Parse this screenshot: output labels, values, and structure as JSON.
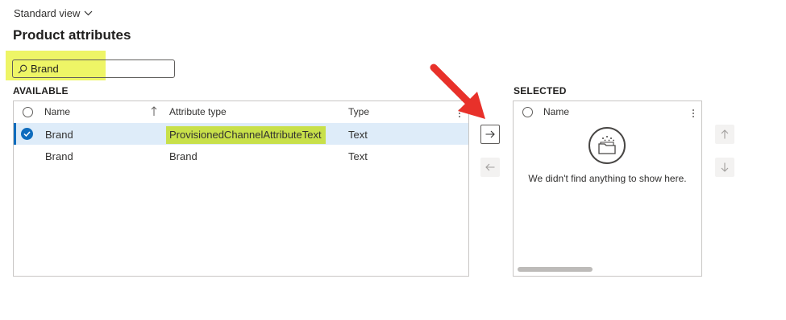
{
  "header": {
    "view_label": "Standard view",
    "title": "Product attributes"
  },
  "search": {
    "value": "Brand",
    "placeholder": ""
  },
  "available": {
    "label": "AVAILABLE",
    "columns": [
      "Name",
      "Attribute type",
      "Type"
    ],
    "rows": [
      {
        "name": "Brand",
        "attribute_type": "ProvisionedChannelAttributeText",
        "type": "Text",
        "selected": true
      },
      {
        "name": "Brand",
        "attribute_type": "Brand",
        "type": "Text",
        "selected": false
      }
    ]
  },
  "selected": {
    "label": "SELECTED",
    "columns": [
      "Name"
    ],
    "empty_message": "We didn't find anything to show here."
  },
  "colors": {
    "highlight": "#eef566",
    "row_selected": "#deecf9",
    "accent": "#0f6cbd",
    "annotation_arrow": "#e8312a"
  },
  "icons": {
    "view": "chevron-down-icon",
    "search": "search-icon",
    "sort": "sort-ascending-icon",
    "empty": "empty-folder-icon",
    "move_right": "arrow-right-icon",
    "move_left": "arrow-left-icon",
    "move_up": "arrow-up-icon",
    "move_down": "arrow-down-icon"
  }
}
